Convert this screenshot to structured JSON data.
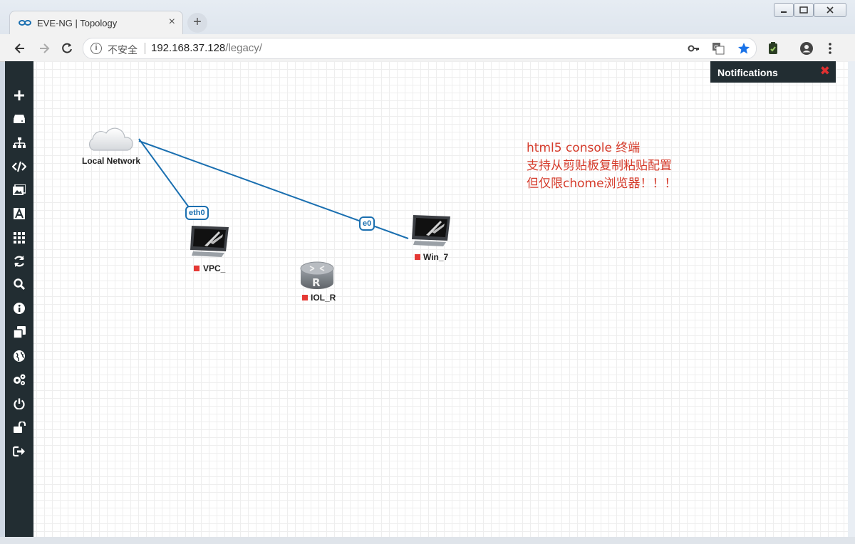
{
  "browser": {
    "tab_title": "EVE-NG | Topology",
    "tab_close": "×",
    "new_tab": "+",
    "security_label": "不安全",
    "url_host": "192.168.37.128",
    "url_path": "/legacy/"
  },
  "sidebar": {
    "items": [
      {
        "icon": "plus-icon"
      },
      {
        "icon": "server-icon"
      },
      {
        "icon": "sitemap-icon"
      },
      {
        "icon": "code-icon"
      },
      {
        "icon": "images-icon"
      },
      {
        "icon": "font-icon"
      },
      {
        "icon": "grid-icon"
      },
      {
        "icon": "refresh-icon"
      },
      {
        "icon": "search-icon"
      },
      {
        "icon": "info-icon"
      },
      {
        "icon": "clone-icon"
      },
      {
        "icon": "globe-icon"
      },
      {
        "icon": "gears-icon"
      },
      {
        "icon": "power-icon"
      },
      {
        "icon": "unlock-icon"
      },
      {
        "icon": "sign-out-icon"
      }
    ]
  },
  "notifications": {
    "title": "Notifications",
    "close": "✖"
  },
  "topology": {
    "nodes": {
      "cloud": "Local Network",
      "vpc": "VPC_",
      "router": "IOL_R",
      "win": "Win_7"
    },
    "interfaces": {
      "cloud_vpc": "eth0",
      "cloud_win": "e0"
    },
    "status_color": "#e53935",
    "link_color": "#1a6fb0"
  },
  "note": {
    "line1": "html5  console 终端",
    "line2": "支持从剪贴板复制粘贴配置",
    "line3": "但仅限chome浏览器！！！"
  }
}
